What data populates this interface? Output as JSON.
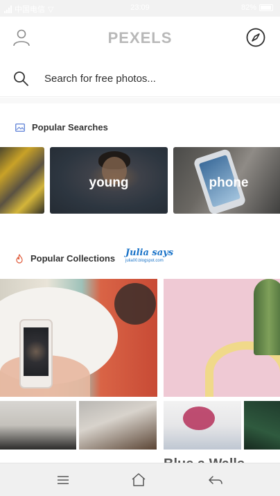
{
  "status_bar": {
    "carrier": "中国电信",
    "time": "23:09",
    "battery": "82%"
  },
  "header": {
    "brand": "PEXELS",
    "icons": {
      "profile": "person-outline-icon",
      "explore": "compass-icon"
    }
  },
  "search": {
    "placeholder": "Search for free photos...",
    "value": ""
  },
  "popular_searches": {
    "title": "Popular Searches",
    "icon": "image-icon",
    "items": [
      {
        "label": ""
      },
      {
        "label": "young"
      },
      {
        "label": "phone"
      }
    ]
  },
  "popular_collections": {
    "title": "Popular Collections",
    "icon": "flame-icon",
    "next_title_partial": "Blue a Walls"
  },
  "watermark": {
    "main": "Julia says",
    "sub": "julia00.blogspot.com"
  },
  "nav_bar": {
    "icons": [
      "menu-icon",
      "home-icon",
      "back-icon"
    ]
  },
  "colors": {
    "brand_text": "#b8b8b8",
    "accent_icon": "#5b7fd6",
    "flame_icon": "#e05a3a",
    "watermark": "#1a73c8"
  }
}
